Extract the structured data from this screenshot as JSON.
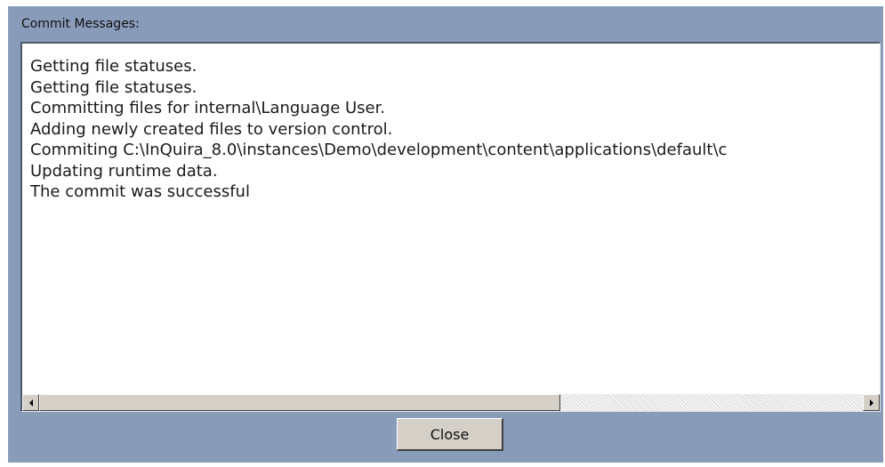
{
  "dialog": {
    "header_label": "Commit Messages:",
    "close_label": "Close"
  },
  "log": {
    "lines": [
      "Getting file statuses.",
      "Getting file statuses.",
      "Committing files for internal\\Language User.",
      "Adding newly created files to version control.",
      "Commiting C:\\InQuira_8.0\\instances\\Demo\\development\\content\\applications\\default\\c",
      "Updating runtime data.",
      "The commit was successful"
    ]
  },
  "scrollbar": {
    "orientation": "horizontal",
    "position_fraction": 0.0,
    "visible_fraction": 0.64,
    "left_arrow_icon": "arrow-left-icon",
    "right_arrow_icon": "arrow-right-icon"
  },
  "colors": {
    "dialog_background": "#889cb9",
    "log_background": "#ffffff",
    "button_face": "#d4d0c8"
  }
}
